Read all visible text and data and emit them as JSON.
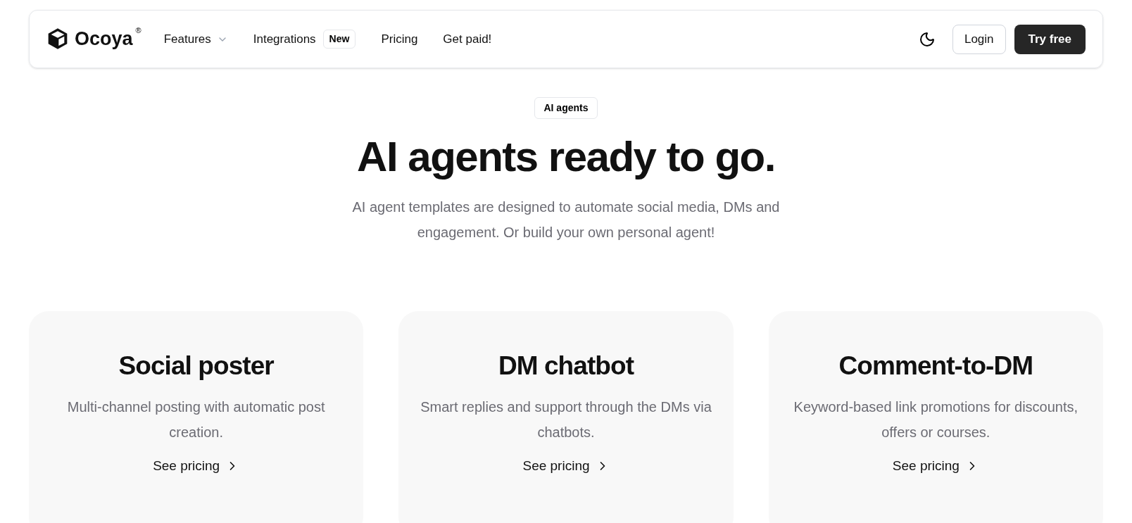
{
  "nav": {
    "brand": "Ocoya",
    "brand_mark": "®",
    "items": [
      {
        "label": "Features",
        "kind": "dropdown"
      },
      {
        "label": "Integrations",
        "kind": "badge",
        "badge": "New"
      },
      {
        "label": "Pricing",
        "kind": "link"
      },
      {
        "label": "Get paid!",
        "kind": "link"
      }
    ],
    "login": "Login",
    "cta": "Try free"
  },
  "hero": {
    "tag": "AI agents",
    "title": "AI agents ready to go.",
    "subtitle": "AI agent templates are designed to automate social media, DMs and engagement. Or build your own personal agent!"
  },
  "cards": [
    {
      "title": "Social poster",
      "text": "Multi-channel posting with automatic post creation.",
      "link": "See pricing"
    },
    {
      "title": "DM chatbot",
      "text": "Smart replies and support through the DMs via chatbots.",
      "link": "See pricing"
    },
    {
      "title": "Comment-to-DM",
      "text": "Keyword-based link promotions for discounts, offers or courses.",
      "link": "See pricing"
    }
  ]
}
